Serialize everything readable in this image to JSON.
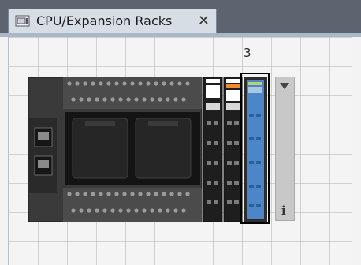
{
  "tab": {
    "title": "CPU/Expansion Racks",
    "close_glyph": "✕"
  },
  "rack": {
    "slot_label": "3"
  },
  "panel": {
    "info_glyph": "i"
  },
  "colors": {
    "tabbar": "#5d6470",
    "tab_active": "#d7dde5",
    "selection_border": "#000000",
    "module_blue": "#4c86c8"
  },
  "icons": [
    "rack-icon",
    "close-icon",
    "chevron-down-icon",
    "info-icon"
  ]
}
